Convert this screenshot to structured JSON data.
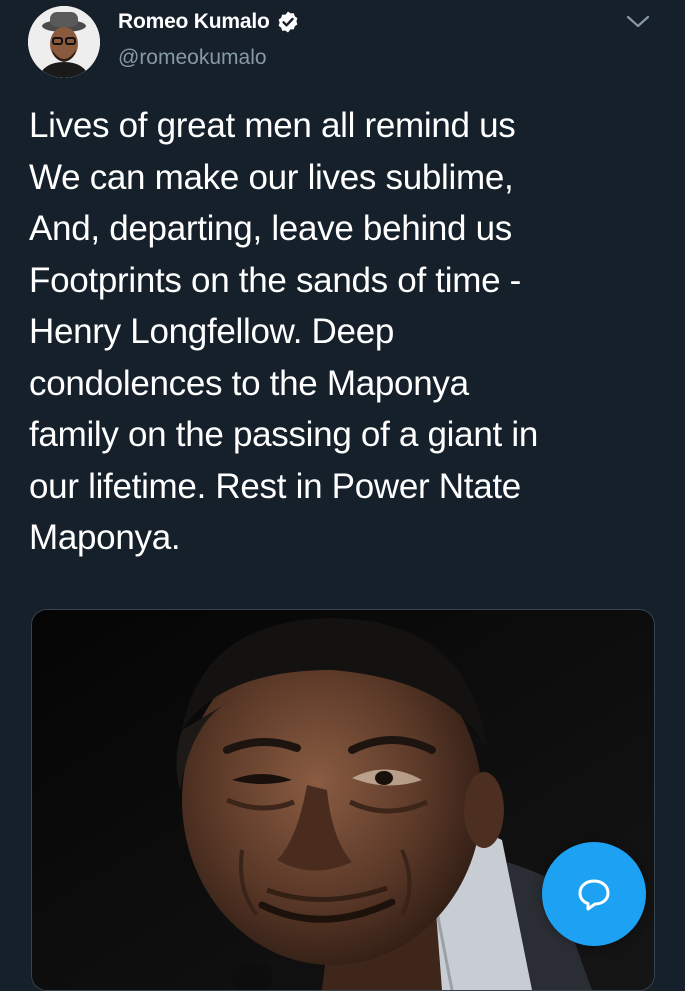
{
  "tweet": {
    "author": {
      "display_name": "Romeo Kumalo",
      "handle": "@romeokumalo",
      "verified": true,
      "avatar_icon": "profile-photo"
    },
    "text": "Lives of great men all remind us\nWe can make our lives sublime,\nAnd, departing, leave behind us\nFootprints on the sands of time -\nHenry Longfellow. Deep\ncondolences to the Maponya\nfamily on the passing of a giant in\nour lifetime. Rest in Power Ntate\nMaponya.",
    "media": {
      "type": "photo",
      "icon": "portrait-photo"
    },
    "menu_icon": "chevron-down-icon"
  },
  "compose_button": {
    "icon": "compose-reply-icon",
    "color": "#1da1f2"
  },
  "colors": {
    "background": "#15202b",
    "secondary_text": "#8899a6",
    "accent": "#1da1f2",
    "border": "#38444d"
  }
}
